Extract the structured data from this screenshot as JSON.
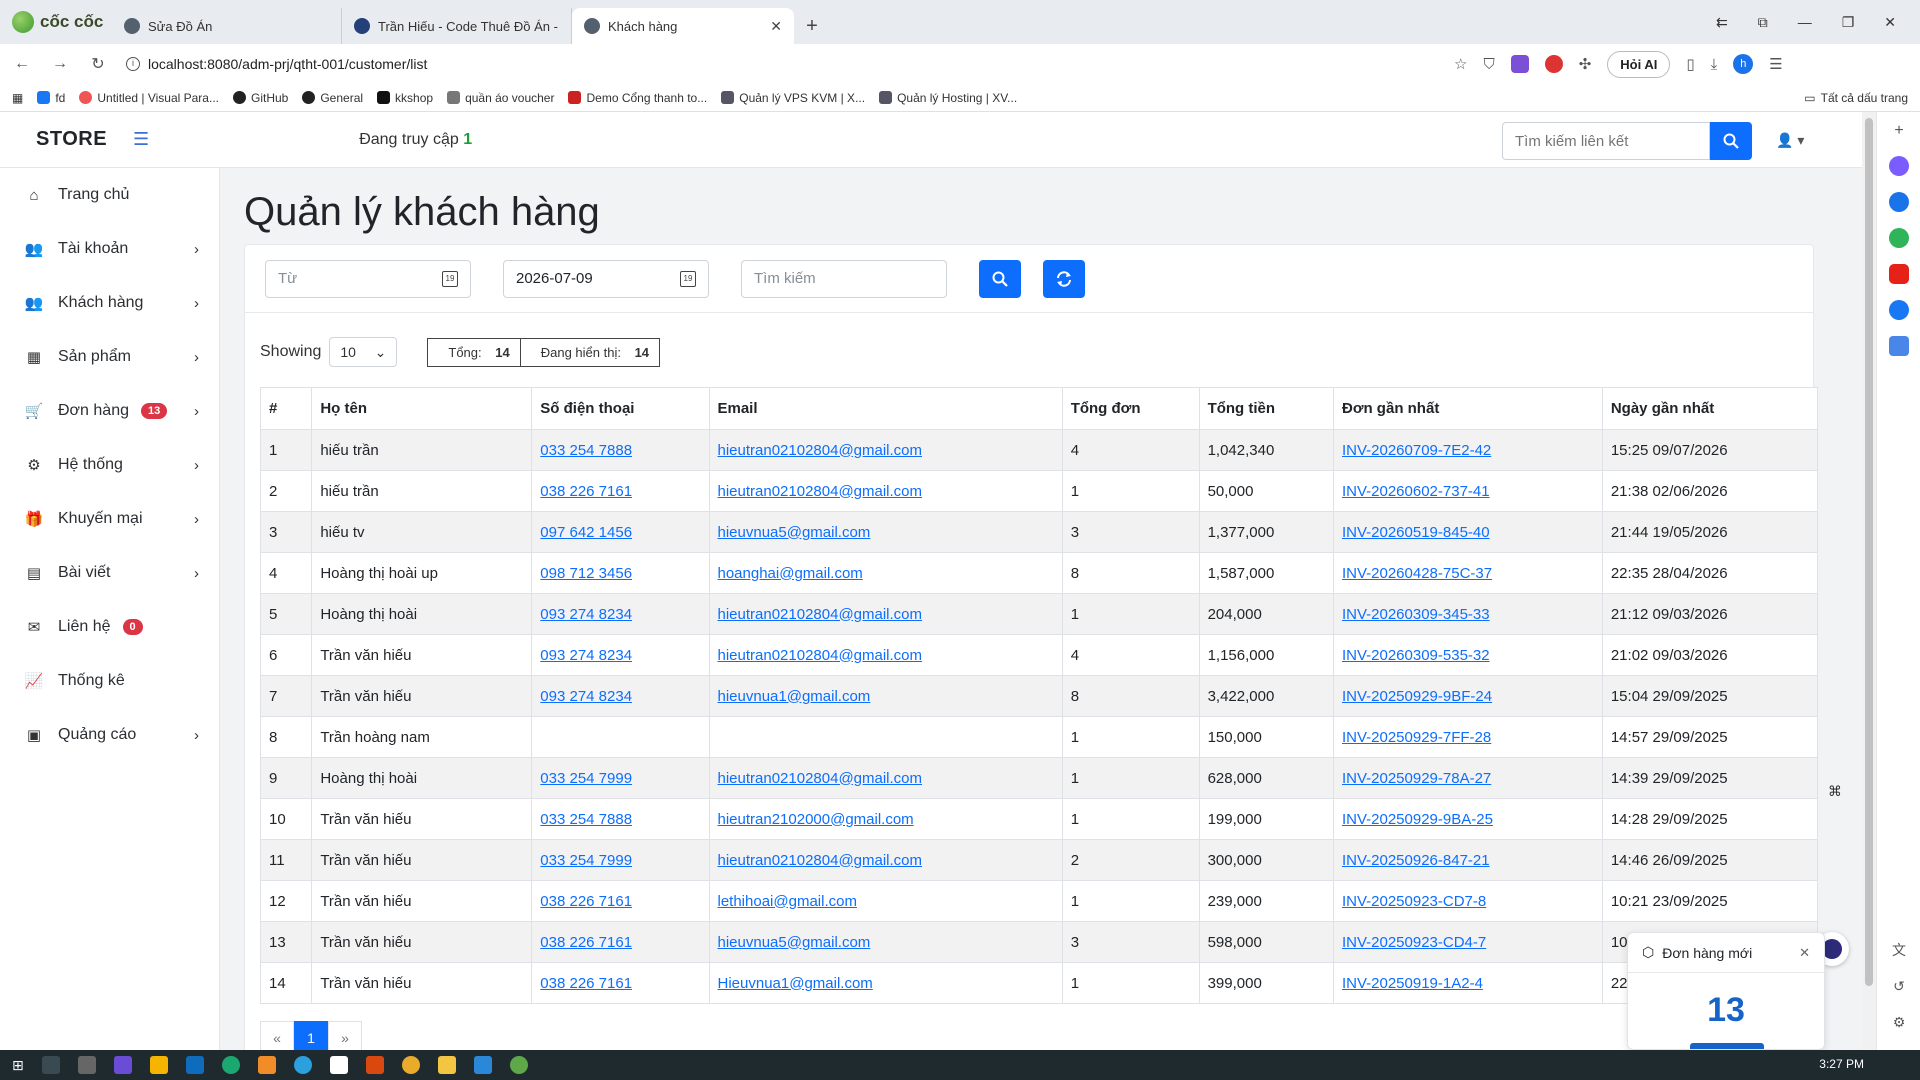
{
  "browser": {
    "brand": "cốc cốc",
    "tabs": [
      {
        "title": "Sửa Đồ Án"
      },
      {
        "title": "Trần Hiếu - Code Thuê Đồ Án - J"
      },
      {
        "title": "Khách hàng"
      }
    ],
    "url": "localhost:8080/adm-prj/qtht-001/customer/list",
    "ask_ai": "Hỏi AI",
    "profile_initial": "h",
    "bookmarks": [
      "fd",
      "Untitled | Visual Para...",
      "GitHub",
      "General",
      "kkshop",
      "quần áo voucher",
      "Demo Cổng thanh to...",
      "Quản lý VPS KVM | X...",
      "Quản lý Hosting | XV..."
    ],
    "all_bookmarks": "Tất cả dấu trang"
  },
  "header": {
    "store": "STORE",
    "online_label": "Đang truy cập",
    "online_count": "1",
    "search_placeholder": "Tìm kiếm liên kết"
  },
  "sidebar": {
    "items": [
      {
        "label": "Trang chủ",
        "icon": "home-icon"
      },
      {
        "label": "Tài khoản",
        "icon": "users-icon"
      },
      {
        "label": "Khách hàng",
        "icon": "user-group-icon"
      },
      {
        "label": "Sản phẩm",
        "icon": "boxes-icon"
      },
      {
        "label": "Đơn hàng",
        "icon": "cart-icon",
        "badge": "13"
      },
      {
        "label": "Hệ thống",
        "icon": "gears-icon"
      },
      {
        "label": "Khuyến mại",
        "icon": "gift-icon"
      },
      {
        "label": "Bài viết",
        "icon": "list-icon"
      },
      {
        "label": "Liên hệ",
        "icon": "envelope-icon",
        "badge": "0"
      },
      {
        "label": "Thống kê",
        "icon": "chart-line-icon"
      },
      {
        "label": "Quảng cáo",
        "icon": "ad-icon"
      }
    ]
  },
  "page": {
    "title": "Quản lý khách hàng",
    "filters": {
      "from_placeholder": "Từ",
      "to_value": "2026-07-09",
      "search_placeholder": "Tìm kiếm"
    },
    "showing_label": "Showing",
    "page_size": "10",
    "total_label": "Tổng:",
    "total_value": "14",
    "shown_label": "Đang hiển thị:",
    "shown_value": "14",
    "columns": [
      "#",
      "Họ tên",
      "Số điện thoại",
      "Email",
      "Tổng đơn",
      "Tổng tiền",
      "Đơn gần nhất",
      "Ngày gần nhất"
    ],
    "rows": [
      [
        "1",
        "hiếu trần",
        "033 254 7888",
        "hieutran02102804@gmail.com",
        "4",
        "1,042,340",
        "INV-20260709-7E2-42",
        "15:25 09/07/2026"
      ],
      [
        "2",
        "hiếu trần",
        "038 226 7161",
        "hieutran02102804@gmail.com",
        "1",
        "50,000",
        "INV-20260602-737-41",
        "21:38 02/06/2026"
      ],
      [
        "3",
        "hiếu tv",
        "097 642 1456",
        "hieuvnua5@gmail.com",
        "3",
        "1,377,000",
        "INV-20260519-845-40",
        "21:44 19/05/2026"
      ],
      [
        "4",
        "Hoàng thị hoài up",
        "098 712 3456",
        "hoanghai@gmail.com",
        "8",
        "1,587,000",
        "INV-20260428-75C-37",
        "22:35 28/04/2026"
      ],
      [
        "5",
        "Hoàng thị hoài",
        "093 274 8234",
        "hieutran02102804@gmail.com",
        "1",
        "204,000",
        "INV-20260309-345-33",
        "21:12 09/03/2026"
      ],
      [
        "6",
        "Trần văn hiếu",
        "093 274 8234",
        "hieutran02102804@gmail.com",
        "4",
        "1,156,000",
        "INV-20260309-535-32",
        "21:02 09/03/2026"
      ],
      [
        "7",
        "Trần văn hiếu",
        "093 274 8234",
        "hieuvnua1@gmail.com",
        "8",
        "3,422,000",
        "INV-20250929-9BF-24",
        "15:04 29/09/2025"
      ],
      [
        "8",
        "Trần hoàng nam",
        "",
        "",
        "1",
        "150,000",
        "INV-20250929-7FF-28",
        "14:57 29/09/2025"
      ],
      [
        "9",
        "Hoàng thị hoài",
        "033 254 7999",
        "hieutran02102804@gmail.com",
        "1",
        "628,000",
        "INV-20250929-78A-27",
        "14:39 29/09/2025"
      ],
      [
        "10",
        "Trần văn hiếu",
        "033 254 7888",
        "hieutran2102000@gmail.com",
        "1",
        "199,000",
        "INV-20250929-9BA-25",
        "14:28 29/09/2025"
      ],
      [
        "11",
        "Trần văn hiếu",
        "033 254 7999",
        "hieutran02102804@gmail.com",
        "2",
        "300,000",
        "INV-20250926-847-21",
        "14:46 26/09/2025"
      ],
      [
        "12",
        "Trần văn hiếu",
        "038 226 7161",
        "lethihoai@gmail.com",
        "1",
        "239,000",
        "INV-20250923-CD7-8",
        "10:21 23/09/2025"
      ],
      [
        "13",
        "Trần văn hiếu",
        "038 226 7161",
        "hieuvnua5@gmail.com",
        "3",
        "598,000",
        "INV-20250923-CD4-7",
        "10"
      ],
      [
        "14",
        "Trần văn hiếu",
        "038 226 7161",
        "Hieuvnua1@gmail.com",
        "1",
        "399,000",
        "INV-20250919-1A2-4",
        "22"
      ]
    ],
    "pagination": {
      "prev": "«",
      "current": "1",
      "next": "»"
    }
  },
  "toast": {
    "title": "Đơn hàng mới",
    "count": "13"
  },
  "taskbar": {
    "time": "3:27 PM"
  }
}
